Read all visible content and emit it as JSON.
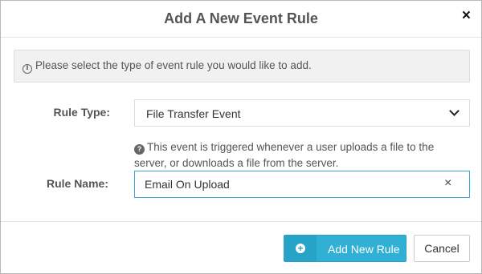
{
  "dialog": {
    "title": "Add A New Event Rule",
    "close_glyph": "×"
  },
  "info": {
    "icon": "info-circle-icon",
    "text": "Please select the type of event rule you would like to add."
  },
  "form": {
    "rule_type_label": "Rule Type:",
    "rule_type_value": "File Transfer Event",
    "help_icon": "question-circle-icon",
    "help_text": "This event is triggered whenever a user uploads a file to the server, or downloads a file from the server.",
    "rule_name_label": "Rule Name:",
    "rule_name_value": "Email On Upload",
    "clear_glyph": "×"
  },
  "footer": {
    "add_label": "Add New Rule",
    "cancel_label": "Cancel"
  },
  "colors": {
    "primary": "#31b0d5",
    "focus_border": "#3aa8d8"
  }
}
